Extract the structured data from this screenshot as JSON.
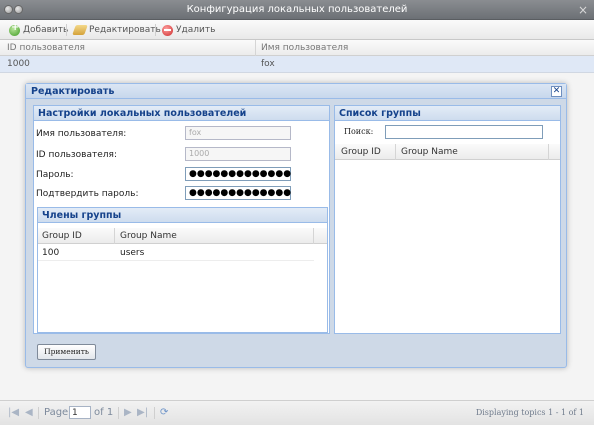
{
  "window": {
    "title": "Конфигурация локальных пользователей",
    "close_glyph": "×"
  },
  "toolbar": {
    "add_label": "Добавить",
    "edit_label": "Редактировать",
    "delete_label": "Удалить"
  },
  "grid": {
    "columns": [
      "ID пользователя",
      "Имя пользователя"
    ],
    "rows": [
      {
        "id": "1000",
        "name": "fox"
      }
    ]
  },
  "dialog": {
    "title": "Редактировать",
    "close_glyph": "✕",
    "settings_panel": {
      "title": "Настройки локальных пользователей",
      "username_label": "Имя пользователя:",
      "username_value": "fox",
      "userid_label": "ID пользователя:",
      "userid_value": "1000",
      "password_label": "Пароль:",
      "password_value": "●●●●●●●●●●●●●",
      "confirm_label": "Подтвердить пароль:",
      "confirm_value": "●●●●●●●●●●●●●"
    },
    "members_panel": {
      "title": "Члены группы",
      "columns": [
        "Group ID",
        "Group Name"
      ],
      "rows": [
        {
          "id": "100",
          "name": "users"
        }
      ]
    },
    "group_list_panel": {
      "title": "Список группы",
      "search_label": "Поиск:",
      "search_value": "",
      "columns": [
        "Group ID",
        "Group Name"
      ]
    },
    "apply_label": "Применить"
  },
  "pager": {
    "page_label": "Page",
    "page_value": "1",
    "of_label": "of 1",
    "display_text": "Displaying topics 1 - 1 of 1"
  }
}
